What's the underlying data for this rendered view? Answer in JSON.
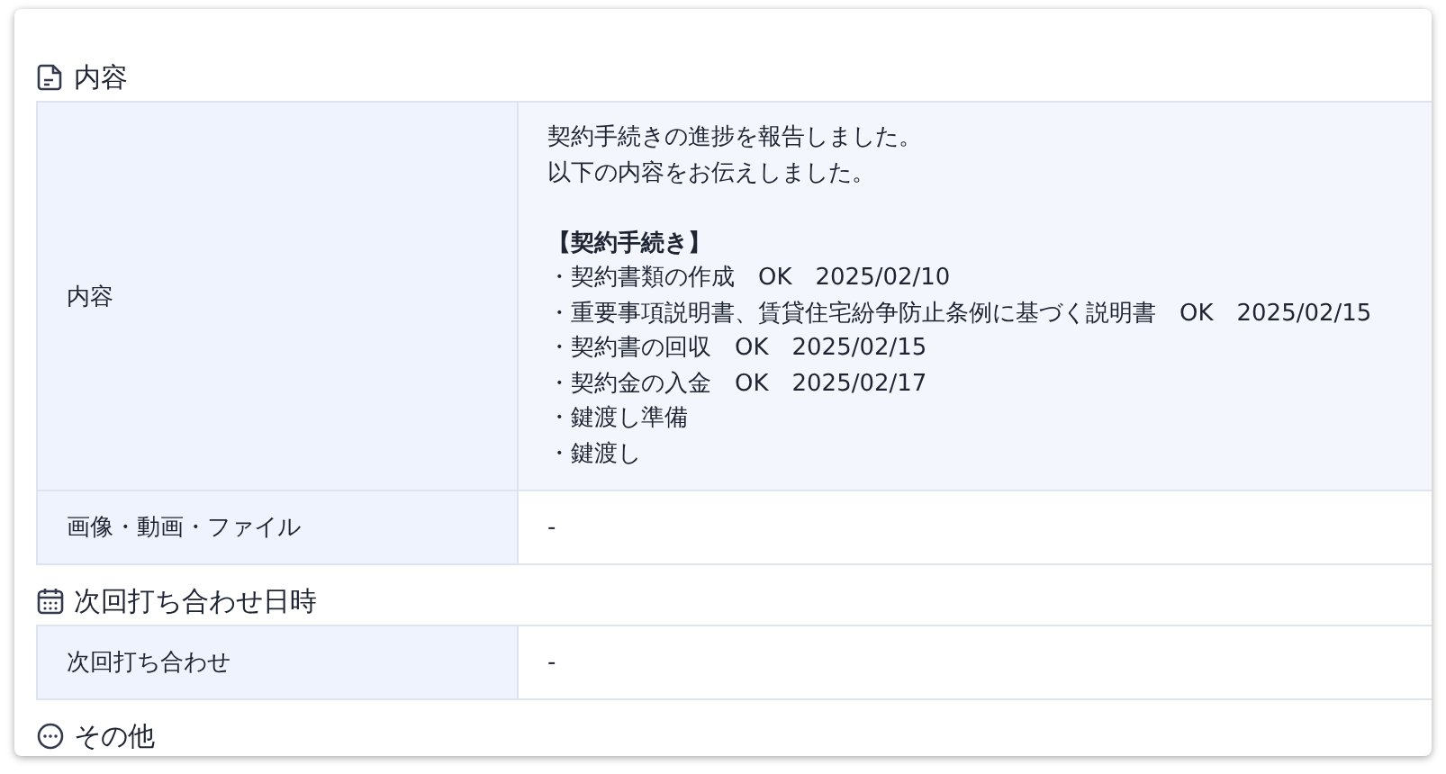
{
  "sections": [
    {
      "kind": "document",
      "title": "内容",
      "rows": [
        {
          "label": "内容",
          "kind": "report",
          "highlighted": true,
          "intro": [
            "契約手続きの進捗を報告しました。",
            "以下の内容をお伝えしました。"
          ],
          "list_title": "【契約手続き】",
          "items": [
            "・契約書類の作成　OK　2025/02/10",
            "・重要事項説明書、賃貸住宅紛争防止条例に基づく説明書　OK　2025/02/15",
            "・契約書の回収　OK　2025/02/15",
            "・契約金の入金　OK　2025/02/17",
            "・鍵渡し準備",
            "・鍵渡し"
          ]
        },
        {
          "label": "画像・動画・ファイル",
          "kind": "text",
          "highlighted": false,
          "value": "-"
        }
      ]
    },
    {
      "kind": "schedule",
      "title": "次回打ち合わせ日時",
      "rows": [
        {
          "label": "次回打ち合わせ",
          "kind": "text",
          "highlighted": false,
          "value": "-"
        }
      ]
    },
    {
      "kind": "other",
      "title": "その他"
    }
  ]
}
